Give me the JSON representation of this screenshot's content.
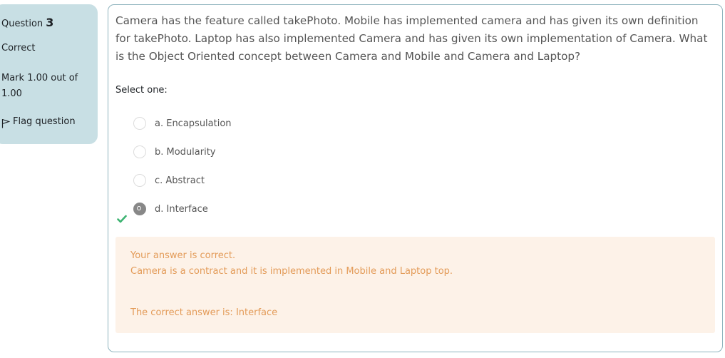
{
  "info": {
    "question_label": "Question",
    "question_number": "3",
    "state": "Correct",
    "grade": "Mark 1.00 out of 1.00",
    "flag_label": "Flag question"
  },
  "question": {
    "text": "Camera has the feature  called takePhoto. Mobile has implemented camera and has given its own definition for takePhoto. Laptop has also implemented Camera and has given its own implementation of Camera. What is the Object Oriented concept between Camera and Mobile and Camera and Laptop?",
    "prompt": "Select one:",
    "options": [
      {
        "label": "a. Encapsulation",
        "selected": false
      },
      {
        "label": "b. Modularity",
        "selected": false
      },
      {
        "label": "c. Abstract",
        "selected": false
      },
      {
        "label": "d. Interface",
        "selected": true
      }
    ]
  },
  "feedback": {
    "result": "Your answer is correct.",
    "general": "Camera is a contract and it is implemented in Mobile and Laptop top.",
    "correct_answer": "The correct answer is: Interface"
  },
  "colors": {
    "info_bg": "#c8dfe4",
    "panel_border": "#8fb4be",
    "feedback_bg": "#fdf2e8",
    "feedback_text": "#e39b58",
    "correct_icon": "#3cb371"
  },
  "icons": {
    "flag": "flag-icon",
    "correct": "check-icon"
  }
}
